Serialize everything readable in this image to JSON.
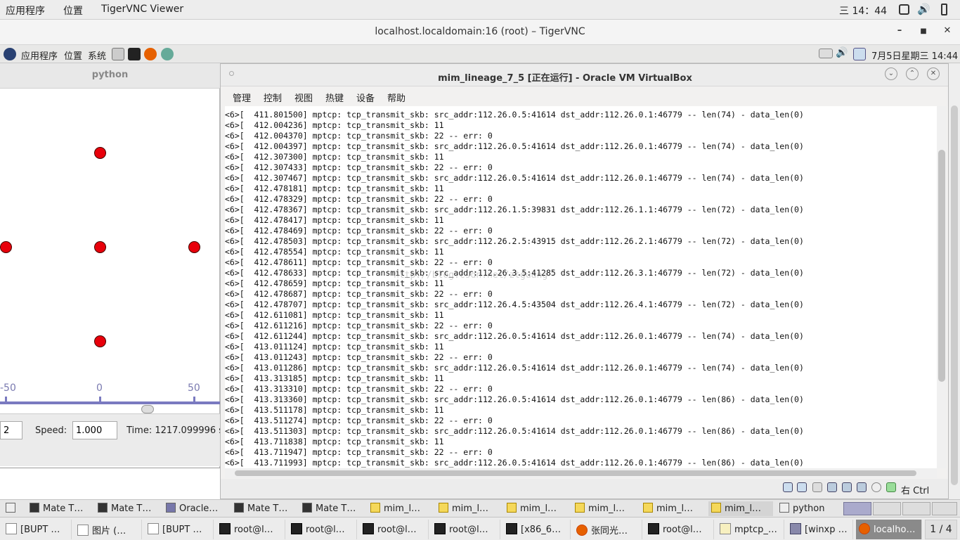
{
  "host_top": {
    "apps_menu": "应用程序",
    "places_menu": "位置",
    "app_name": "TigerVNC Viewer",
    "clock": "三 14：44"
  },
  "vnc_window": {
    "title": "localhost.localdomain:16 (root) – TigerVNC",
    "minimize": "–",
    "maximize": "■",
    "close": "✕"
  },
  "remote_top": {
    "apps_menu": "应用程序",
    "places_menu": "位置",
    "system_menu": "系统",
    "datetime": "7月5日星期三 14:44"
  },
  "python_app": {
    "title": "python",
    "ticks": [
      "-50",
      "0",
      "50"
    ],
    "speed_label": "Speed:",
    "speed_value": "1.000",
    "left_spin_value": "2",
    "time_label": "Time: 1217.099996 s"
  },
  "vbox": {
    "title": "mim_lineage_7_5 [正在运行] - Oracle VM VirtualBox",
    "menu": [
      "管理",
      "控制",
      "视图",
      "热键",
      "设备",
      "帮助"
    ],
    "host_key": "右 Ctrl",
    "watermark": "http://blog.csdn.net/ztguang",
    "console_lines": [
      "<6>[  411.801500] mptcp: tcp_transmit_skb: src_addr:112.26.0.5:41614 dst_addr:112.26.0.1:46779 -- len(74) - data_len(0)",
      "<6>[  412.004236] mptcp: tcp_transmit_skb: 11",
      "<6>[  412.004370] mptcp: tcp_transmit_skb: 22 -- err: 0",
      "<6>[  412.004397] mptcp: tcp_transmit_skb: src_addr:112.26.0.5:41614 dst_addr:112.26.0.1:46779 -- len(74) - data_len(0)",
      "<6>[  412.307300] mptcp: tcp_transmit_skb: 11",
      "<6>[  412.307433] mptcp: tcp_transmit_skb: 22 -- err: 0",
      "<6>[  412.307467] mptcp: tcp_transmit_skb: src_addr:112.26.0.5:41614 dst_addr:112.26.0.1:46779 -- len(74) - data_len(0)",
      "<6>[  412.478181] mptcp: tcp_transmit_skb: 11",
      "<6>[  412.478329] mptcp: tcp_transmit_skb: 22 -- err: 0",
      "<6>[  412.478367] mptcp: tcp_transmit_skb: src_addr:112.26.1.5:39831 dst_addr:112.26.1.1:46779 -- len(72) - data_len(0)",
      "<6>[  412.478417] mptcp: tcp_transmit_skb: 11",
      "<6>[  412.478469] mptcp: tcp_transmit_skb: 22 -- err: 0",
      "<6>[  412.478503] mptcp: tcp_transmit_skb: src_addr:112.26.2.5:43915 dst_addr:112.26.2.1:46779 -- len(72) - data_len(0)",
      "<6>[  412.478554] mptcp: tcp_transmit_skb: 11",
      "<6>[  412.478611] mptcp: tcp_transmit_skb: 22 -- err: 0",
      "<6>[  412.478633] mptcp: tcp_transmit_skb: src_addr:112.26.3.5:41285 dst_addr:112.26.3.1:46779 -- len(72) - data_len(0)",
      "<6>[  412.478659] mptcp: tcp_transmit_skb: 11",
      "<6>[  412.478687] mptcp: tcp_transmit_skb: 22 -- err: 0",
      "<6>[  412.478707] mptcp: tcp_transmit_skb: src_addr:112.26.4.5:43504 dst_addr:112.26.4.1:46779 -- len(72) - data_len(0)",
      "<6>[  412.611081] mptcp: tcp_transmit_skb: 11",
      "<6>[  412.611216] mptcp: tcp_transmit_skb: 22 -- err: 0",
      "<6>[  412.611244] mptcp: tcp_transmit_skb: src_addr:112.26.0.5:41614 dst_addr:112.26.0.1:46779 -- len(74) - data_len(0)",
      "<6>[  413.011124] mptcp: tcp_transmit_skb: 11",
      "<6>[  413.011243] mptcp: tcp_transmit_skb: 22 -- err: 0",
      "<6>[  413.011286] mptcp: tcp_transmit_skb: src_addr:112.26.0.5:41614 dst_addr:112.26.0.1:46779 -- len(74) - data_len(0)",
      "<6>[  413.313185] mptcp: tcp_transmit_skb: 11",
      "<6>[  413.313310] mptcp: tcp_transmit_skb: 22 -- err: 0",
      "<6>[  413.313360] mptcp: tcp_transmit_skb: src_addr:112.26.0.5:41614 dst_addr:112.26.0.1:46779 -- len(86) - data_len(0)",
      "<6>[  413.511178] mptcp: tcp_transmit_skb: 11",
      "<6>[  413.511274] mptcp: tcp_transmit_skb: 22 -- err: 0",
      "<6>[  413.511303] mptcp: tcp_transmit_skb: src_addr:112.26.0.5:41614 dst_addr:112.26.0.1:46779 -- len(86) - data_len(0)",
      "<6>[  413.711838] mptcp: tcp_transmit_skb: 11",
      "<6>[  413.711947] mptcp: tcp_transmit_skb: 22 -- err: 0",
      "<6>[  413.711993] mptcp: tcp_transmit_skb: src_addr:112.26.0.5:41614 dst_addr:112.26.0.1:46779 -- len(86) - data_len(0)"
    ]
  },
  "remote_taskbar": {
    "items": [
      "Mate T…",
      "Mate T…",
      "Oracle…",
      "Mate T…",
      "Mate T…",
      "mim_l…",
      "mim_l…",
      "mim_l…",
      "mim_l…",
      "mim_l…",
      "mim_l…",
      "python"
    ]
  },
  "host_taskbar": {
    "items": [
      "[BUPT …",
      "图片 (…",
      "[BUPT …",
      "root@l…",
      "root@l…",
      "root@l…",
      "root@l…",
      "[x86_6…",
      "张同光…",
      "root@l…",
      "mptcp_…",
      "[winxp …",
      "localho…"
    ],
    "workspace": "1 / 4"
  },
  "colors": {
    "node": "#e8000b",
    "axis": "#7a7ac0"
  }
}
